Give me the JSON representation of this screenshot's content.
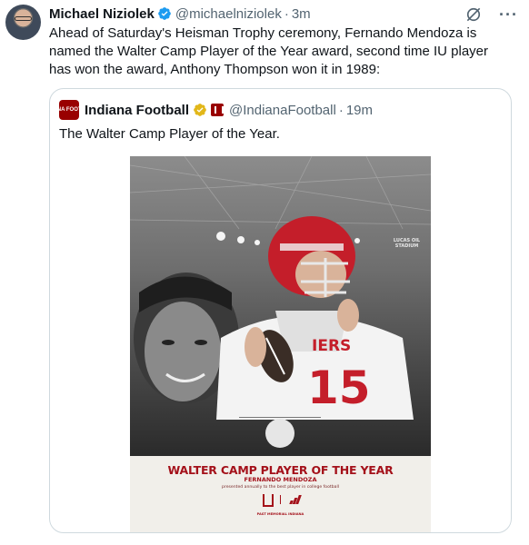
{
  "tweet": {
    "author_name": "Michael Niziolek",
    "author_handle": "@michaelniziolek",
    "separator": "·",
    "time": "3m",
    "text": "Ahead of Saturday's Heisman Trophy ceremony, Fernando Mendoza is named the Walter Camp Player of the Year award, second time IU player has won the award, Anthony Thompson won it in 1989:",
    "icons": [
      "grok-icon",
      "more-icon"
    ]
  },
  "quoted": {
    "author_name": "Indiana Football",
    "author_handle": "@IndianaFootball",
    "separator": "·",
    "time": "19m",
    "avatar_text": "INDIANA FOOTBALL",
    "text": "The Walter Camp Player of the Year."
  },
  "poster": {
    "title": "WALTER CAMP PLAYER OF THE YEAR",
    "name": "FERNANDO MENDOZA",
    "tagline": "presented annually to the best player in college football",
    "jersey_text": "IERS",
    "jersey_number": "15",
    "stadium_sign": "LUCAS OIL STADIUM",
    "footer": "PAST MEMORIAL INDIANA"
  },
  "colors": {
    "verified_blue": "#1d9bf0",
    "gold_check": "#e2b719",
    "crimson": "#990000"
  }
}
